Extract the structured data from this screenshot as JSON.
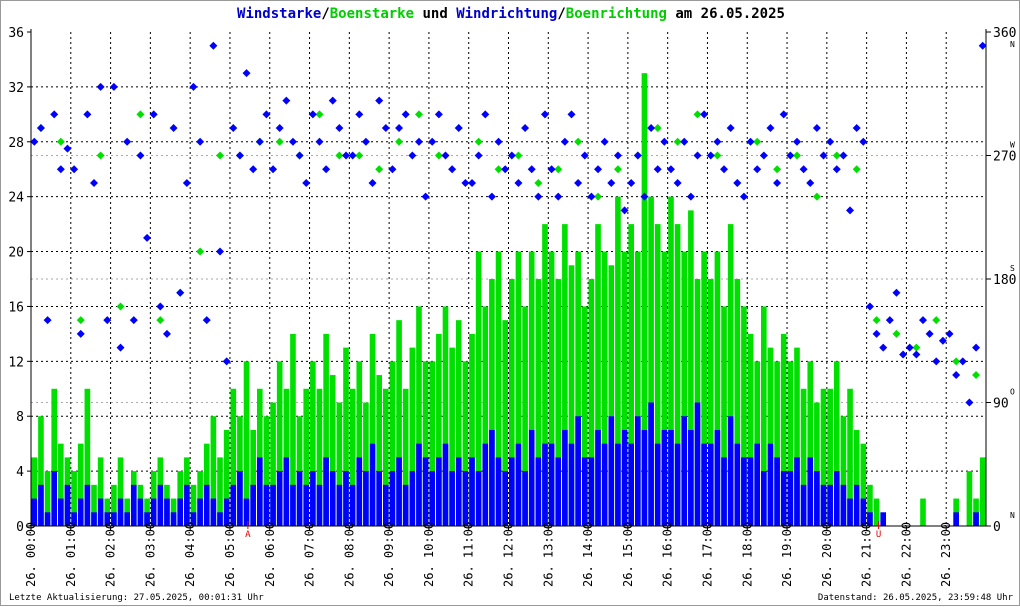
{
  "chart_data": {
    "type": "scatter",
    "title": {
      "parts": [
        "Windstarke",
        "/",
        "Boenstarke",
        " und ",
        "Windrichtung",
        "/",
        "Boenrichtung",
        " am 26.05.2025"
      ],
      "colors": [
        "#0000cc",
        "#000000",
        "#00cc00",
        "#000000",
        "#0000cc",
        "#000000",
        "#00cc00",
        "#000000"
      ]
    },
    "x_range_hours": [
      0,
      24
    ],
    "y_left": {
      "range": [
        0,
        36
      ],
      "ticks": [
        "0",
        "4",
        "8",
        "12",
        "16",
        "20",
        "24",
        "28",
        "32",
        "36"
      ]
    },
    "y_right": {
      "range": [
        0,
        360
      ],
      "ticks": [
        "0",
        "90",
        "180",
        "270",
        "360"
      ],
      "compass": [
        "N",
        "O",
        "S",
        "W",
        "N"
      ]
    },
    "x_tick_labels": [
      "26. 00:00",
      "26. 01:00",
      "26. 02:00",
      "26. 03:00",
      "26. 04:00",
      "26. 05:00",
      "26. 06:00",
      "26. 07:00",
      "26. 08:00",
      "26. 09:00",
      "26. 10:00",
      "26. 11:00",
      "26. 12:00",
      "26. 13:00",
      "26. 14:00",
      "26. 15:00",
      "26. 16:00",
      "26. 17:00",
      "26. 18:00",
      "26. 19:00",
      "26. 20:00",
      "26. 21:00",
      "26. 22:00",
      "26. 23:00"
    ],
    "markers": [
      {
        "label": "A",
        "hour": 5.45
      },
      {
        "label": "U",
        "hour": 21.3
      }
    ],
    "interval_minutes": 10,
    "series": [
      {
        "name": "Windstarke",
        "color": "#0000ff",
        "kind": "bar",
        "values": [
          2,
          3,
          1,
          4,
          2,
          3,
          1,
          2,
          3,
          1,
          2,
          1,
          1,
          2,
          1,
          3,
          2,
          1,
          2,
          3,
          2,
          1,
          2,
          3,
          1,
          2,
          3,
          2,
          1,
          2,
          3,
          4,
          2,
          3,
          5,
          3,
          3,
          4,
          5,
          3,
          4,
          3,
          4,
          3,
          5,
          4,
          3,
          4,
          3,
          5,
          4,
          6,
          4,
          3,
          4,
          5,
          3,
          4,
          6,
          5,
          4,
          5,
          6,
          4,
          5,
          4,
          5,
          4,
          6,
          7,
          5,
          4,
          5,
          6,
          4,
          7,
          5,
          6,
          6,
          5,
          7,
          6,
          8,
          5,
          5,
          7,
          6,
          8,
          6,
          7,
          6,
          8,
          7,
          9,
          6,
          7,
          7,
          6,
          8,
          7,
          9,
          6,
          6,
          7,
          5,
          8,
          6,
          5,
          5,
          6,
          4,
          6,
          5,
          4,
          4,
          5,
          3,
          5,
          4,
          3,
          3,
          4,
          3,
          2,
          3,
          2,
          1,
          0,
          1,
          0,
          0,
          0,
          0,
          0,
          0,
          0,
          0,
          0,
          0,
          1,
          0,
          0,
          1,
          0
        ]
      },
      {
        "name": "Boenstarke",
        "color": "#00e000",
        "kind": "bar",
        "values": [
          5,
          8,
          4,
          10,
          6,
          5,
          4,
          6,
          10,
          3,
          5,
          2,
          3,
          5,
          2,
          4,
          3,
          2,
          4,
          5,
          3,
          2,
          4,
          5,
          3,
          4,
          6,
          8,
          5,
          7,
          10,
          8,
          12,
          7,
          10,
          8,
          9,
          12,
          10,
          14,
          8,
          10,
          12,
          10,
          14,
          11,
          9,
          13,
          10,
          12,
          9,
          14,
          11,
          10,
          12,
          15,
          10,
          13,
          16,
          12,
          12,
          14,
          16,
          13,
          15,
          12,
          14,
          20,
          16,
          18,
          20,
          15,
          18,
          20,
          16,
          20,
          18,
          22,
          20,
          18,
          22,
          19,
          20,
          16,
          18,
          22,
          20,
          19,
          24,
          20,
          22,
          20,
          33,
          24,
          22,
          20,
          24,
          22,
          20,
          23,
          18,
          20,
          18,
          20,
          16,
          22,
          18,
          16,
          14,
          12,
          16,
          13,
          12,
          14,
          12,
          13,
          10,
          12,
          9,
          10,
          10,
          12,
          8,
          10,
          7,
          6,
          3,
          2,
          0,
          0,
          0,
          0,
          0,
          0,
          2,
          0,
          0,
          0,
          0,
          2,
          0,
          4,
          2,
          5
        ]
      },
      {
        "name": "Windrichtung",
        "color": "#0000ff",
        "kind": "scatter",
        "unit": "deg",
        "values": [
          280,
          290,
          150,
          300,
          260,
          275,
          260,
          140,
          300,
          250,
          320,
          150,
          320,
          130,
          280,
          150,
          270,
          210,
          300,
          160,
          140,
          290,
          170,
          250,
          320,
          280,
          150,
          350,
          200,
          120,
          290,
          270,
          330,
          260,
          280,
          300,
          260,
          290,
          310,
          280,
          270,
          250,
          300,
          280,
          260,
          310,
          290,
          270,
          270,
          300,
          280,
          250,
          310,
          290,
          260,
          290,
          300,
          270,
          280,
          240,
          280,
          300,
          270,
          260,
          290,
          250,
          250,
          270,
          300,
          240,
          280,
          260,
          270,
          250,
          290,
          260,
          240,
          300,
          260,
          240,
          280,
          300,
          250,
          270,
          240,
          260,
          280,
          250,
          270,
          230,
          250,
          270,
          240,
          290,
          260,
          280,
          260,
          250,
          280,
          240,
          270,
          300,
          270,
          280,
          260,
          290,
          250,
          240,
          280,
          260,
          270,
          290,
          250,
          300,
          270,
          280,
          260,
          250,
          290,
          270,
          280,
          260,
          270,
          230,
          290,
          280,
          160,
          140,
          130,
          150,
          170,
          125,
          130,
          125,
          150,
          140,
          120,
          135,
          140,
          110,
          120,
          90,
          130,
          350
        ]
      },
      {
        "name": "Boenrichtung",
        "color": "#00e000",
        "kind": "scatter",
        "unit": "deg",
        "interval_minutes": 30,
        "values": [
          290,
          280,
          150,
          270,
          160,
          300,
          150,
          170,
          200,
          270,
          270,
          280,
          280,
          270,
          300,
          270,
          270,
          260,
          280,
          300,
          270,
          290,
          280,
          260,
          270,
          250,
          260,
          280,
          240,
          260,
          270,
          290,
          280,
          300,
          270,
          250,
          280,
          260,
          270,
          240,
          270,
          260,
          150,
          140,
          130,
          150,
          120,
          110
        ]
      }
    ]
  },
  "footer": {
    "last_update": "Letzte Aktualisierung: 27.05.2025, 00:01:31 Uhr",
    "data_state": "Datenstand: 26.05.2025, 23:59:48 Uhr"
  }
}
